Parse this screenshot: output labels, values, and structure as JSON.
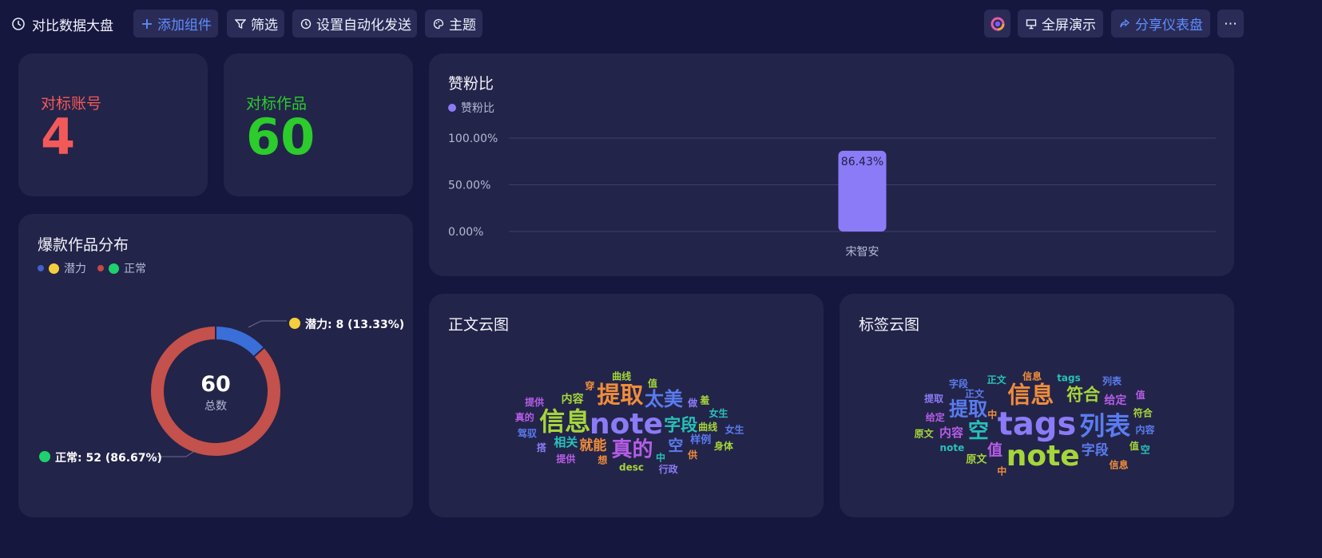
{
  "header": {
    "title": "对比数据大盘",
    "add_widget": "添加组件",
    "filter": "筛选",
    "auto_send": "设置自动化发送",
    "theme": "主题",
    "fullscreen": "全屏演示",
    "share": "分享仪表盘",
    "more": "⋯"
  },
  "kpis": [
    {
      "label": "对标账号",
      "value": "4",
      "color": "#f25a5a"
    },
    {
      "label": "对标作品",
      "value": "60",
      "color": "#2bcc2b"
    }
  ],
  "donut_card": {
    "title": "爆款作品分布",
    "legend": [
      {
        "name": "潜力",
        "color": "#f5cf3b",
        "marker": "#3f63c9"
      },
      {
        "name": "正常",
        "color": "#1fd06e",
        "marker": "#c44a44"
      }
    ],
    "center_value": "60",
    "center_label": "总数",
    "labels": [
      {
        "text": "潜力: 8 (13.33%)",
        "color": "#f5cf3b"
      },
      {
        "text": "正常: 52 (86.67%)",
        "color": "#1fd06e"
      }
    ],
    "chart_data": {
      "type": "pie",
      "title": "爆款作品分布",
      "slices": [
        {
          "name": "潜力",
          "value": 8,
          "percent": 13.33,
          "color": "#3a6ed8"
        },
        {
          "name": "正常",
          "value": 52,
          "percent": 86.67,
          "color": "#c4514b"
        }
      ],
      "total": 60
    }
  },
  "bar_card": {
    "title": "赞粉比",
    "legend_label": "赞粉比",
    "legend_color": "#8b7bf6",
    "chart_data": {
      "type": "bar",
      "title": "赞粉比",
      "categories": [
        "宋智安"
      ],
      "series": [
        {
          "name": "赞粉比",
          "values": [
            86.43
          ]
        }
      ],
      "value_labels": [
        "86.43%"
      ],
      "yticks": [
        "0.00%",
        "50.00%",
        "100.00%"
      ],
      "ylim": [
        0,
        100
      ],
      "bar_color": "#8b7bf6",
      "grid": true
    }
  },
  "wordcloud_text": {
    "title": "正文云图",
    "words": [
      {
        "t": "note",
        "c": "#8b7bf6"
      },
      {
        "t": "信息",
        "c": "#a5d63a"
      },
      {
        "t": "提取",
        "c": "#f08d3a"
      },
      {
        "t": "真的",
        "c": "#b55de6"
      },
      {
        "t": "太美",
        "c": "#5a7cf0"
      },
      {
        "t": "字段",
        "c": "#26c2b8"
      },
      {
        "t": "空",
        "c": "#5a7cf0"
      },
      {
        "t": "就能",
        "c": "#f08d3a"
      },
      {
        "t": "相关",
        "c": "#26c2b8"
      },
      {
        "t": "内容",
        "c": "#a5d63a"
      },
      {
        "t": "样例",
        "c": "#5a7cf0"
      },
      {
        "t": "做",
        "c": "#8b7bf6"
      },
      {
        "t": "曲线",
        "c": "#a5d63a"
      },
      {
        "t": "女生",
        "c": "#26c2b8"
      },
      {
        "t": "中",
        "c": "#26c2b8"
      },
      {
        "t": "desc",
        "c": "#a5d63a"
      },
      {
        "t": "想",
        "c": "#f08d3a"
      },
      {
        "t": "穿",
        "c": "#f08d3a"
      },
      {
        "t": "值",
        "c": "#a5d63a"
      },
      {
        "t": "羞",
        "c": "#a5d63a"
      },
      {
        "t": "提供",
        "c": "#b55de6"
      },
      {
        "t": "供",
        "c": "#f08d3a"
      },
      {
        "t": "搭",
        "c": "#8b7bf6"
      },
      {
        "t": "驾驭",
        "c": "#5a7cf0"
      },
      {
        "t": "真的",
        "c": "#b55de6"
      },
      {
        "t": "提供",
        "c": "#b55de6"
      },
      {
        "t": "曲线",
        "c": "#a5d63a"
      },
      {
        "t": "女生",
        "c": "#5a7cf0"
      },
      {
        "t": "身体",
        "c": "#a5d63a"
      },
      {
        "t": "行政",
        "c": "#8b7bf6"
      }
    ]
  },
  "wordcloud_tags": {
    "title": "标签云图",
    "words": [
      {
        "t": "tags",
        "c": "#8b7bf6"
      },
      {
        "t": "note",
        "c": "#a5d63a"
      },
      {
        "t": "列表",
        "c": "#5a7cf0"
      },
      {
        "t": "信息",
        "c": "#f08d3a"
      },
      {
        "t": "空",
        "c": "#26c2b8"
      },
      {
        "t": "提取",
        "c": "#5a7cf0"
      },
      {
        "t": "符合",
        "c": "#a5d63a"
      },
      {
        "t": "值",
        "c": "#b55de6"
      },
      {
        "t": "字段",
        "c": "#5a7cf0"
      },
      {
        "t": "内容",
        "c": "#b55de6"
      },
      {
        "t": "给定",
        "c": "#b55de6"
      },
      {
        "t": "原文",
        "c": "#a5d63a"
      },
      {
        "t": "正文",
        "c": "#5a7cf0"
      },
      {
        "t": "中",
        "c": "#f08d3a"
      },
      {
        "t": "note",
        "c": "#26c2b8"
      },
      {
        "t": "给定",
        "c": "#b55de6"
      },
      {
        "t": "正文",
        "c": "#26c2b8"
      },
      {
        "t": "信息",
        "c": "#f08d3a"
      },
      {
        "t": "tags",
        "c": "#26c2b8"
      },
      {
        "t": "符合",
        "c": "#a5d63a"
      },
      {
        "t": "内容",
        "c": "#5a7cf0"
      },
      {
        "t": "值",
        "c": "#a5d63a"
      },
      {
        "t": "原文",
        "c": "#a5d63a"
      },
      {
        "t": "提取",
        "c": "#8b7bf6"
      },
      {
        "t": "字段",
        "c": "#5a7cf0"
      },
      {
        "t": "列表",
        "c": "#5a7cf0"
      },
      {
        "t": "中",
        "c": "#f08d3a"
      },
      {
        "t": "值",
        "c": "#b55de6"
      },
      {
        "t": "信息",
        "c": "#f08d3a"
      },
      {
        "t": "空",
        "c": "#26c2b8"
      }
    ]
  }
}
